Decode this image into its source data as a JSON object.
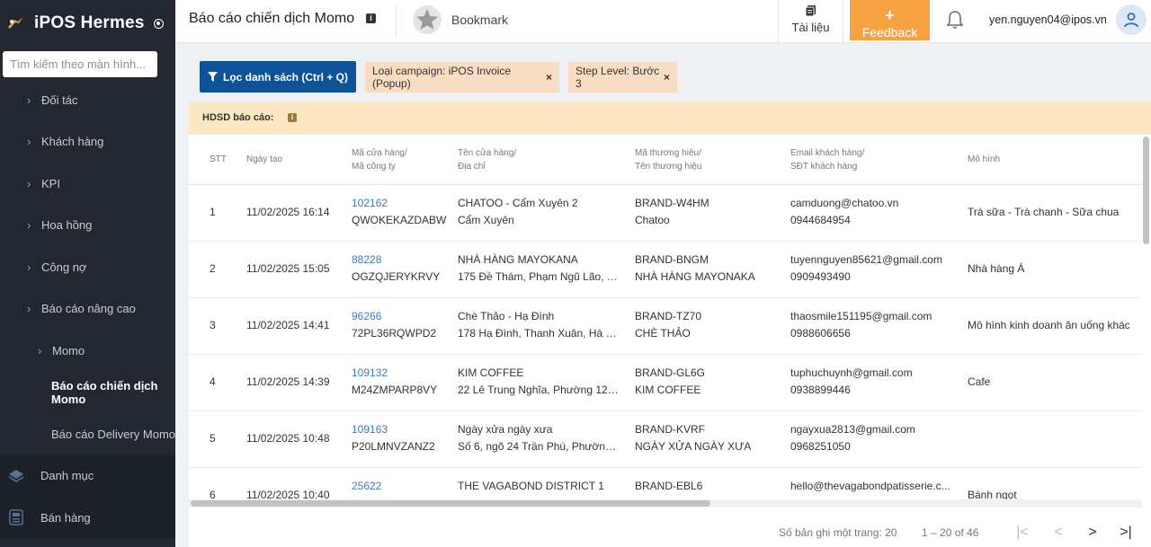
{
  "sidebar": {
    "brand": "iPOS Hermes",
    "search_placeholder": "Tìm kiếm theo màn hình...",
    "items": [
      {
        "label": "Đối tác"
      },
      {
        "label": "Khách hàng"
      },
      {
        "label": "KPI"
      },
      {
        "label": "Hoa hồng"
      },
      {
        "label": "Công nợ"
      },
      {
        "label": "Báo cáo nâng cao"
      },
      {
        "label": "Momo"
      },
      {
        "label": "Báo cáo chiến dịch Momo"
      },
      {
        "label": "Báo cáo Delivery Momo"
      },
      {
        "label": "Danh mục"
      },
      {
        "label": "Bán hàng"
      }
    ]
  },
  "header": {
    "title": "Báo cáo chiến dịch Momo",
    "bookmark": "Bookmark",
    "docs": "Tài liệu",
    "feedback_plus": "+",
    "feedback": "Feedback",
    "user_email": "yen.nguyen04@ipos.vn"
  },
  "filters": {
    "button": "Lọc danh sách (Ctrl + Q)",
    "chips": [
      {
        "label": "Loại campaign: iPOS Invoice (Popup)",
        "close": "×"
      },
      {
        "label": "Step Level: Bước 3",
        "close": "×"
      }
    ]
  },
  "guide": {
    "label": "HDSD báo cáo:"
  },
  "table": {
    "headers": [
      {
        "l1": "STT",
        "l2": ""
      },
      {
        "l1": "Ngày tạo",
        "l2": ""
      },
      {
        "l1": "Mã cửa hàng/",
        "l2": "Mã công ty"
      },
      {
        "l1": "Tên cửa hàng/",
        "l2": "Địa chỉ"
      },
      {
        "l1": "Mã thương hiệu/",
        "l2": "Tên thương hiệu"
      },
      {
        "l1": "Email khách hàng/",
        "l2": "SĐT khách hàng"
      },
      {
        "l1": "Mô hình",
        "l2": ""
      }
    ],
    "rows": [
      {
        "stt": "1",
        "date": "11/02/2025 16:14",
        "store_code": "102162",
        "company_code": "QWOKEKAZDABW",
        "store_name": "CHATOO - Cẩm Xuyên 2",
        "address": "Cẩm Xuyên",
        "brand_code": "BRAND-W4HM",
        "brand_name": "Chatoo",
        "email": "camduong@chatoo.vn",
        "phone": "0944684954",
        "model": "Trà sữa - Trà chanh - Sữa chua"
      },
      {
        "stt": "2",
        "date": "11/02/2025 15:05",
        "store_code": "88228",
        "company_code": "OGZQJERYKRVY",
        "store_name": "NHÀ HÀNG MAYOKANA",
        "address": "175 Đề Thám, Phạm Ngũ Lão, Q...",
        "brand_code": "BRAND-BNGM",
        "brand_name": "NHÀ HÀNG MAYONAKA",
        "email": "tuyennguyen85621@gmail.com",
        "phone": "0909493490",
        "model": "Nhà hàng Á"
      },
      {
        "stt": "3",
        "date": "11/02/2025 14:41",
        "store_code": "96266",
        "company_code": "72PL36RQWPD2",
        "store_name": "Chè Thảo - Hạ Đình",
        "address": "178 Hạ Đình, Thanh Xuân, Hà Nội",
        "brand_code": "BRAND-TZ70",
        "brand_name": "CHÈ THẢO",
        "email": "thaosmile151195@gmail.com",
        "phone": "0988606656",
        "model": "Mô hình kinh doanh ăn uống khác"
      },
      {
        "stt": "4",
        "date": "11/02/2025 14:39",
        "store_code": "109132",
        "company_code": "M24ZMPARP8VY",
        "store_name": "KIM COFFEE",
        "address": "22 Lê Trung Nghĩa, Phường 12, ...",
        "brand_code": "BRAND-GL6G",
        "brand_name": "KIM COFFEE",
        "email": "tuphuchuynh@gmail.com",
        "phone": "0938899446",
        "model": "Cafe"
      },
      {
        "stt": "5",
        "date": "11/02/2025 10:48",
        "store_code": "109163",
        "company_code": "P20LMNVZANZ2",
        "store_name": "Ngày xửa ngày xưa",
        "address": "Số 6, ngõ 24 Trần Phú, Phường ...",
        "brand_code": "BRAND-KVRF",
        "brand_name": "NGÀY XỬA NGÀY XƯA",
        "email": "ngayxua2813@gmail.com",
        "phone": "0968251050",
        "model": ""
      },
      {
        "stt": "6",
        "date": "11/02/2025 10:40",
        "store_code": "25622",
        "company_code": "",
        "store_name": "THE VAGABOND DISTRICT 1",
        "address": "",
        "brand_code": "BRAND-EBL6",
        "brand_name": "",
        "email": "hello@thevagabondpatisserie.c...",
        "phone": "",
        "model": "Bánh ngọt"
      }
    ]
  },
  "footer": {
    "per_page": "Số bản ghi một trang: 20",
    "range": "1 – 20 of 46",
    "first": "|<",
    "prev": "<",
    "next": ">",
    "last": ">|"
  },
  "colors": {
    "sidebar": "#232830",
    "primary": "#0e5398",
    "feedback": "#f6a243",
    "chip": "#f9ddc2",
    "guide": "#fbe8c3",
    "link": "#3b7bc8"
  }
}
